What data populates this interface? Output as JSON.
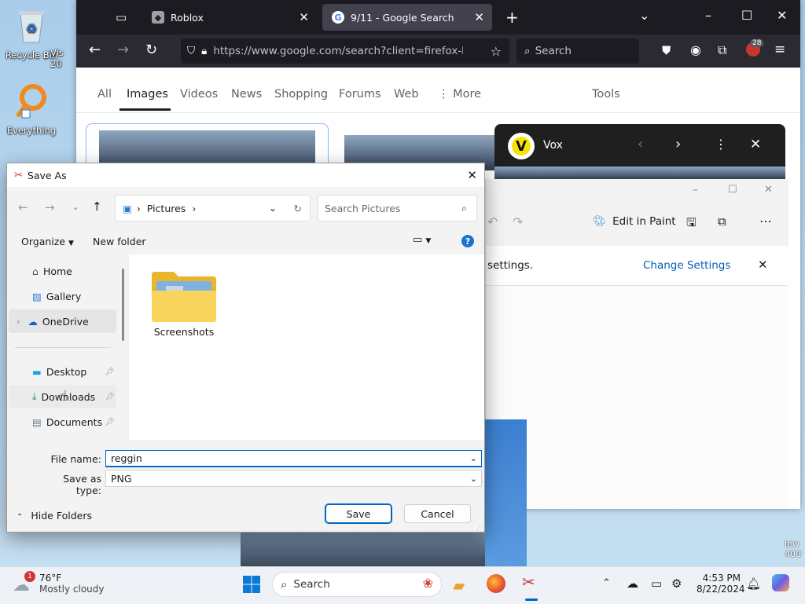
{
  "desktop": {
    "icons": [
      {
        "label": "Recycle Bin"
      },
      {
        "label": "Everything"
      },
      {
        "label": "Vis"
      },
      {
        "label": "20"
      }
    ],
    "edge_text_1": "iew",
    "edge_text_2": "400"
  },
  "browser": {
    "tabs": [
      {
        "label": "Roblox",
        "active": false
      },
      {
        "label": "9/11 - Google Search",
        "active": true
      }
    ],
    "url": "https://www.google.com/search?client=firefox-b-1-d",
    "search_placeholder": "Search",
    "extension_badge": "28",
    "google_nav": [
      {
        "label": "All"
      },
      {
        "label": "Images",
        "selected": true
      },
      {
        "label": "Videos"
      },
      {
        "label": "News"
      },
      {
        "label": "Shopping"
      },
      {
        "label": "Forums"
      },
      {
        "label": "Web"
      },
      {
        "label": "More"
      }
    ],
    "tools_label": "Tools"
  },
  "vox_popup": {
    "logo_letter": "V",
    "title": "Vox"
  },
  "snip_window": {
    "edit_in_paint": "Edit in Paint",
    "info_text": "settings.",
    "change_settings": "Change Settings"
  },
  "dialog": {
    "title": "Save As",
    "address_crumb": "Pictures",
    "search_placeholder": "Search Pictures",
    "organize_label": "Organize",
    "new_folder_label": "New folder",
    "nav_items": [
      {
        "label": "Home"
      },
      {
        "label": "Gallery"
      },
      {
        "label": "OneDrive"
      },
      {
        "label": "Desktop"
      },
      {
        "label": "Downloads"
      },
      {
        "label": "Documents"
      }
    ],
    "folders": [
      {
        "label": "Screenshots"
      }
    ],
    "file_name_label": "File name:",
    "file_name_value": "reggin",
    "save_type_label": "Save as type:",
    "save_type_value": "PNG",
    "hide_folders_label": "Hide Folders",
    "save_button": "Save",
    "cancel_button": "Cancel",
    "accent_color": "#0067c0"
  },
  "taskbar": {
    "weather_temp": "76°F",
    "weather_desc": "Mostly cloudy",
    "weather_badge": "1",
    "search_label": "Search",
    "time": "4:53 PM",
    "date": "8/22/2024"
  }
}
